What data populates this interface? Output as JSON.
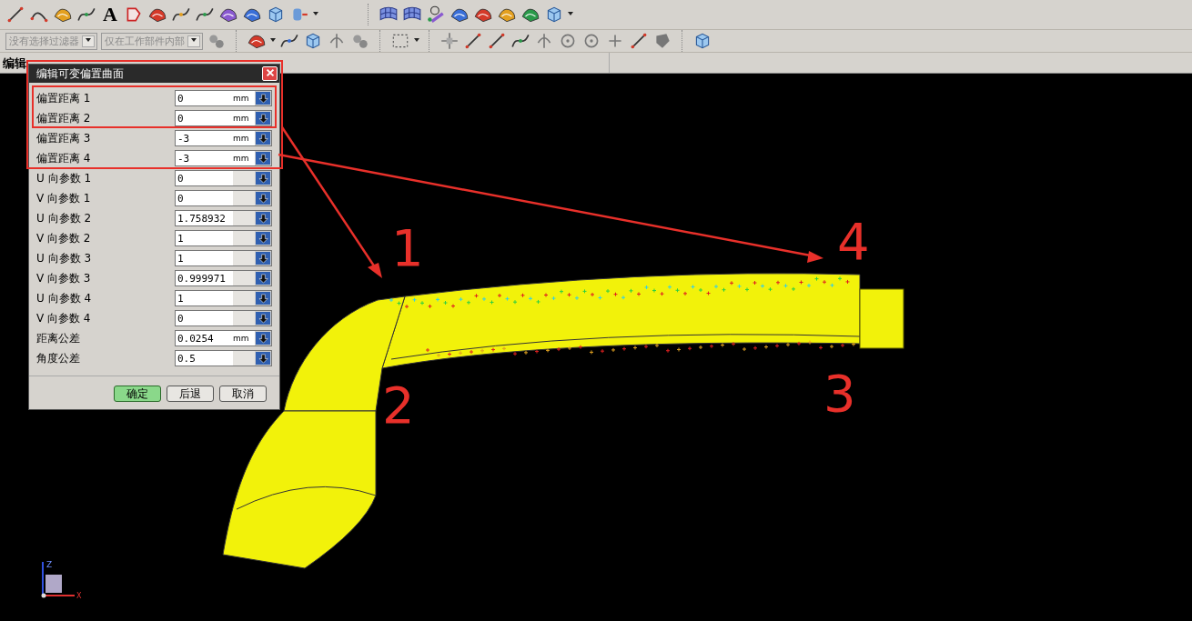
{
  "toolbar": {
    "text_tool": "A"
  },
  "filters": [
    {
      "value": "没有选择过滤器",
      "disabled": true
    },
    {
      "value": "仅在工作部件内部",
      "disabled": true
    }
  ],
  "cue_line": "编辑",
  "dialog": {
    "title": "编辑可变偏置曲面",
    "fields": [
      {
        "label": "偏置距离 1",
        "value": "0",
        "unit": "mm"
      },
      {
        "label": "偏置距离 2",
        "value": "0",
        "unit": "mm"
      },
      {
        "label": "偏置距离 3",
        "value": "-3",
        "unit": "mm"
      },
      {
        "label": "偏置距离 4",
        "value": "-3",
        "unit": "mm"
      },
      {
        "label": "U 向参数 1",
        "value": "0"
      },
      {
        "label": "V 向参数 1",
        "value": "0"
      },
      {
        "label": "U 向参数 2",
        "value": "1.758932"
      },
      {
        "label": "V 向参数 2",
        "value": "1"
      },
      {
        "label": "U 向参数 3",
        "value": "1"
      },
      {
        "label": "V 向参数 3",
        "value": "0.999971"
      },
      {
        "label": "U 向参数 4",
        "value": "1"
      },
      {
        "label": "V 向参数 4",
        "value": "0"
      },
      {
        "label": "距离公差",
        "value": "0.0254",
        "unit": "mm"
      },
      {
        "label": "角度公差",
        "value": "0.5"
      }
    ],
    "buttons": [
      {
        "label": "确定",
        "default": true
      },
      {
        "label": "后退",
        "default": false
      },
      {
        "label": "取消",
        "default": false
      }
    ]
  },
  "annotations": [
    {
      "label": "1"
    },
    {
      "label": "4"
    },
    {
      "label": "2"
    },
    {
      "label": "3"
    }
  ],
  "triad": {
    "z": "Z",
    "x": "X"
  }
}
